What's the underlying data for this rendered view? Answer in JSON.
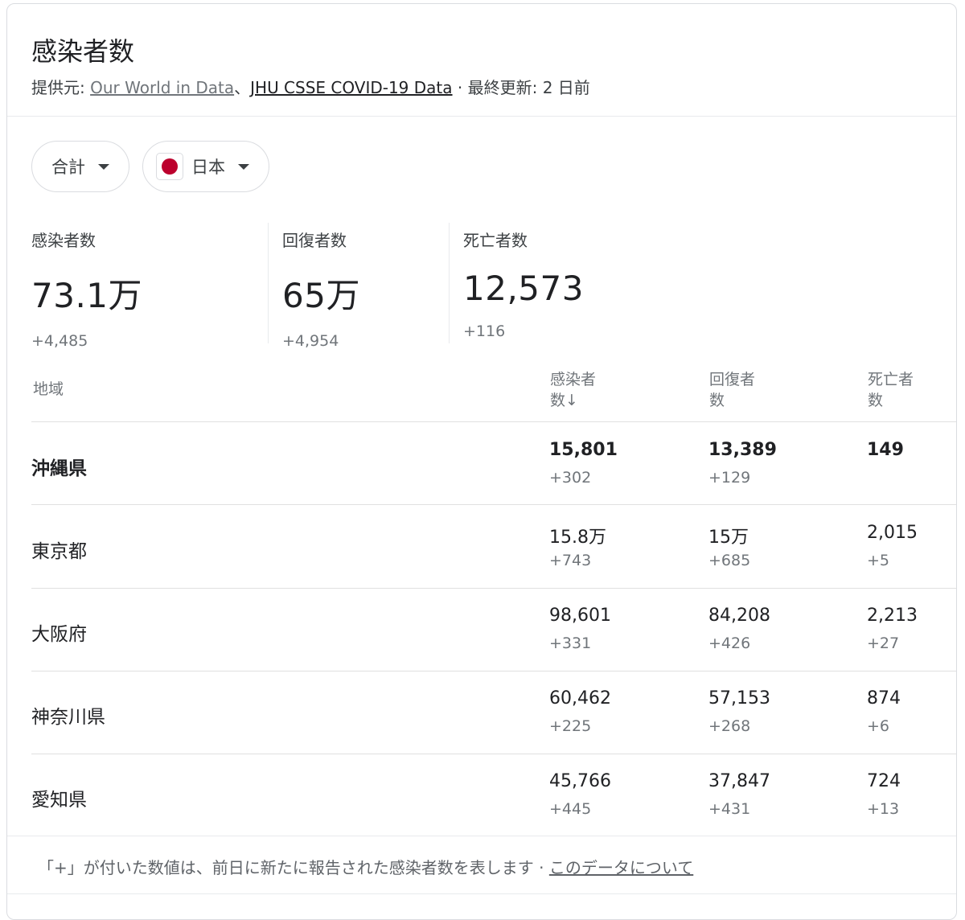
{
  "header": {
    "title": "感染者数",
    "source_prefix": "提供元: ",
    "source_link1": "Our World in Data",
    "source_sep": "、",
    "source_link2": "JHU CSSE COVID-19 Data",
    "updated": " · 最終更新: 2 日前"
  },
  "filters": {
    "total_label": "合計",
    "country_label": "日本",
    "flag_icon": "japan-flag-icon"
  },
  "stats": [
    {
      "label": "感染者数",
      "value": "73.1万",
      "delta": "+4,485"
    },
    {
      "label": "回復者数",
      "value": "65万",
      "delta": "+4,954"
    },
    {
      "label": "死亡者数",
      "value": "12,573",
      "delta": "+116"
    }
  ],
  "table": {
    "headers": {
      "region": "地域",
      "cases_line1": "感染者",
      "cases_line2": "数↓",
      "recovered_line1": "回復者",
      "recovered_line2": "数",
      "deaths_line1": "死亡者",
      "deaths_line2": "数"
    },
    "rows": [
      {
        "region": "沖縄県",
        "cases": "15,801",
        "cases_delta": "+302",
        "recovered": "13,389",
        "recovered_delta": "+129",
        "deaths": "149",
        "deaths_delta": ""
      },
      {
        "region": "東京都",
        "cases": "15.8万",
        "cases_delta": "+743",
        "recovered": "15万",
        "recovered_delta": "+685",
        "deaths": "2,015",
        "deaths_delta": "+5"
      },
      {
        "region": "大阪府",
        "cases": "98,601",
        "cases_delta": "+331",
        "recovered": "84,208",
        "recovered_delta": "+426",
        "deaths": "2,213",
        "deaths_delta": "+27"
      },
      {
        "region": "神奈川県",
        "cases": "60,462",
        "cases_delta": "+225",
        "recovered": "57,153",
        "recovered_delta": "+268",
        "deaths": "874",
        "deaths_delta": "+6"
      },
      {
        "region": "愛知県",
        "cases": "45,766",
        "cases_delta": "+445",
        "recovered": "37,847",
        "recovered_delta": "+431",
        "deaths": "724",
        "deaths_delta": "+13"
      }
    ]
  },
  "footer": {
    "note": "「+」が付いた数値は、前日に新たに報告された感染者数を表します",
    "sep": " · ",
    "about_link": "このデータについて"
  }
}
